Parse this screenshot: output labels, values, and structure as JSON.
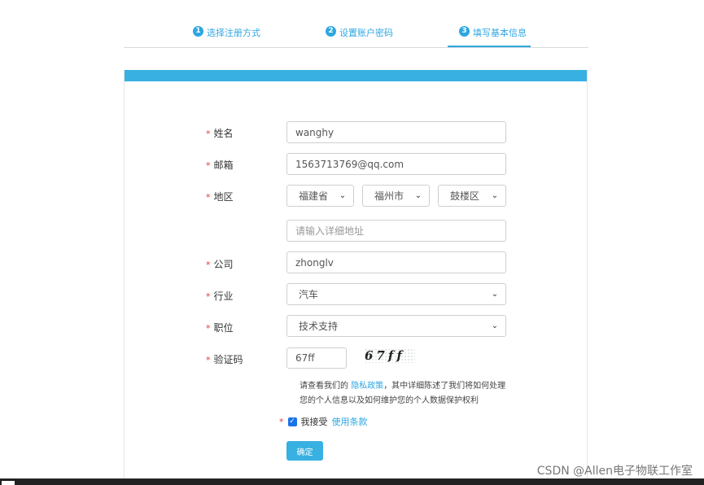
{
  "steps": [
    {
      "num": "1",
      "label": "选择注册方式"
    },
    {
      "num": "2",
      "label": "设置账户密码"
    },
    {
      "num": "3",
      "label": "填写基本信息"
    }
  ],
  "form": {
    "name": {
      "label": "姓名",
      "value": "wanghy"
    },
    "email": {
      "label": "邮箱",
      "value": "1563713769@qq.com"
    },
    "region": {
      "label": "地区",
      "province": "福建省",
      "city": "福州市",
      "district": "鼓楼区"
    },
    "address": {
      "placeholder": "请输入详细地址"
    },
    "company": {
      "label": "公司",
      "value": "zhonglv"
    },
    "industry": {
      "label": "行业",
      "value": "汽车"
    },
    "position": {
      "label": "职位",
      "value": "技术支持"
    },
    "captcha": {
      "label": "验证码",
      "value": "67ff",
      "image_text": "67ff"
    }
  },
  "policy": {
    "prefix": "请查看我们的 ",
    "link": "隐私政策",
    "suffix": "，其中详细陈述了我们将如何处理您的个人信息以及如何维护您的个人数据保护权利"
  },
  "agree": {
    "star": "*",
    "text": "我接受 ",
    "link": "使用条款",
    "checked": true
  },
  "submit_label": "确定",
  "required_mark": "*",
  "watermark": "CSDN @Allen电子物联工作室",
  "colors": {
    "accent": "#38b0e2",
    "required": "#e4393c",
    "checkbox": "#1a73e8"
  }
}
